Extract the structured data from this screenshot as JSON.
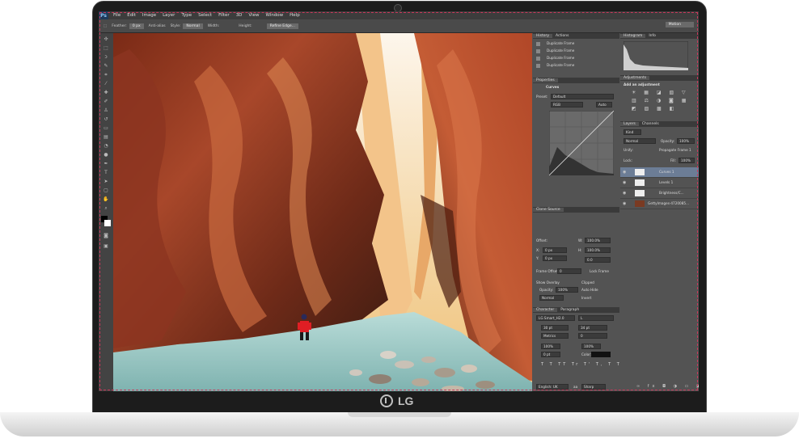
{
  "brand": {
    "label": "LG"
  },
  "app": {
    "logo": "Ps"
  },
  "menu": [
    "File",
    "Edit",
    "Image",
    "Layer",
    "Type",
    "Select",
    "Filter",
    "3D",
    "View",
    "Window",
    "Help"
  ],
  "options_bar": {
    "feather_label": "Feather:",
    "feather_value": "0 px",
    "antialias": "Anti-alias",
    "style_label": "Style:",
    "style_value": "Normal",
    "width_label": "Width:",
    "height_label": "Height:",
    "refine_edge": "Refine Edge...",
    "workspace": "Motion"
  },
  "history": {
    "tabs": [
      "History",
      "Actions"
    ],
    "items": [
      "Duplicate Frame",
      "Duplicate Frame",
      "Duplicate Frame",
      "Duplicate Frame"
    ]
  },
  "properties": {
    "tab": "Properties",
    "title": "Curves",
    "preset_label": "Preset:",
    "preset_value": "Default",
    "channel": "RGB",
    "auto": "Auto"
  },
  "clone_source": {
    "tab": "Clone Source",
    "offset_label": "Offset:",
    "x_label": "X:",
    "x_value": "0 px",
    "y_label": "Y:",
    "y_value": "0 px",
    "w_label": "W:",
    "w_value": "100.0%",
    "h_label": "H:",
    "h_value": "100.0%",
    "angle_value": "0.0",
    "frame_offset_label": "Frame Offset:",
    "frame_offset_value": "0",
    "lock_frame": "Lock Frame",
    "show_overlay": "Show Overlay",
    "opacity_label": "Opacity:",
    "opacity_value": "100%",
    "clipped": "Clipped",
    "auto_hide": "Auto Hide",
    "invert": "Invert",
    "blend": "Normal"
  },
  "character": {
    "tabs": [
      "Character",
      "Paragraph"
    ],
    "font": "LG Smart_H2.0",
    "style": "L",
    "size": "30 pt",
    "leading": "34 pt",
    "kerning": "Metrics",
    "tracking": "0",
    "vscale": "100%",
    "hscale": "100%",
    "baseline": "0 pt",
    "color_label": "Color:",
    "language": "English: UK",
    "aa_label": "aa",
    "aa_value": "Sharp"
  },
  "histogram": {
    "tabs": [
      "Histogram",
      "Info"
    ]
  },
  "adjustments": {
    "tab": "Adjustments",
    "title": "Add an adjustment"
  },
  "layers": {
    "tabs": [
      "Layers",
      "Channels"
    ],
    "kind": "Kind",
    "blend": "Normal",
    "opacity_label": "Opacity:",
    "opacity_value": "100%",
    "unify_label": "Unify:",
    "propagate": "Propagate Frame 1",
    "lock_label": "Lock:",
    "fill_label": "Fill:",
    "fill_value": "100%",
    "items": [
      "Curves 1",
      "Levels 1",
      "Brightness/C...",
      "GettyImages-4720085..."
    ]
  },
  "colors": {
    "accent_border": "#c8375a",
    "panel_bg": "#535353",
    "laptop_bezel": "#1c1c1c"
  }
}
